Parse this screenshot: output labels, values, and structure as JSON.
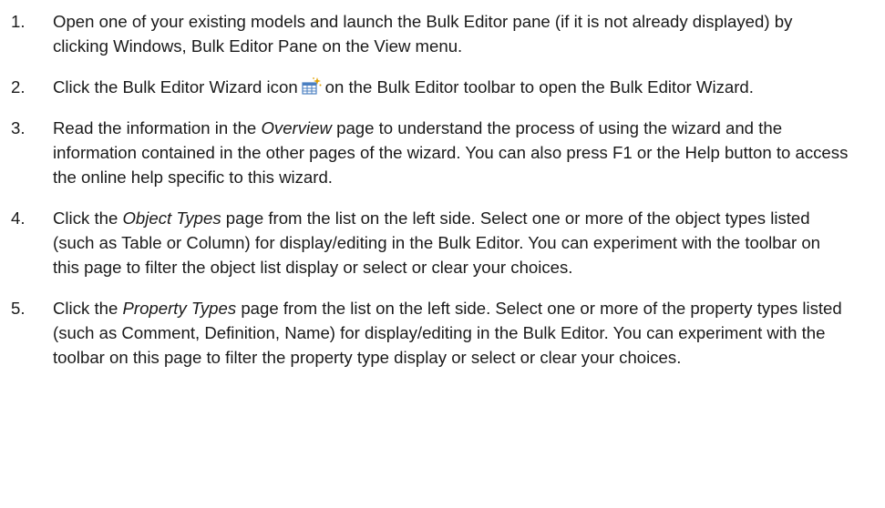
{
  "steps": [
    {
      "number": "1.",
      "parts": [
        "Open one of your existing models and launch the Bulk Editor pane (if it is not already displayed) by clicking Windows, Bulk Editor Pane on the View menu."
      ]
    },
    {
      "number": "2.",
      "parts": [
        "Click the Bulk Editor Wizard icon",
        "on the Bulk Editor toolbar to open the Bulk Editor Wizard."
      ],
      "icon": "bulk-editor-wizard-icon"
    },
    {
      "number": "3.",
      "parts": [
        "Read the information in the ",
        "Overview",
        " page to understand the process of using the wizard and the information contained in the other pages of the wizard. You can also press F1 or the Help button to access the online help specific to this wizard."
      ]
    },
    {
      "number": "4.",
      "parts": [
        "Click the ",
        "Object Types",
        " page from the list on the left side. Select one or more of the object types listed (such as Table or Column) for display/editing in the Bulk Editor. You can experiment with the toolbar on this page to filter the object list display or select or clear your choices."
      ]
    },
    {
      "number": "5.",
      "parts": [
        "Click the ",
        "Property Types",
        " page from the list on the left side. Select one or more of the property types listed (such as Comment, Definition, Name) for display/editing in the Bulk Editor. You can experiment with the toolbar on this page to filter the property type display or select or clear your choices."
      ]
    }
  ],
  "colors": {
    "text": "#1a1a1a",
    "icon_grid": "#4a7fc1",
    "icon_sparkle": "#e0a000"
  }
}
